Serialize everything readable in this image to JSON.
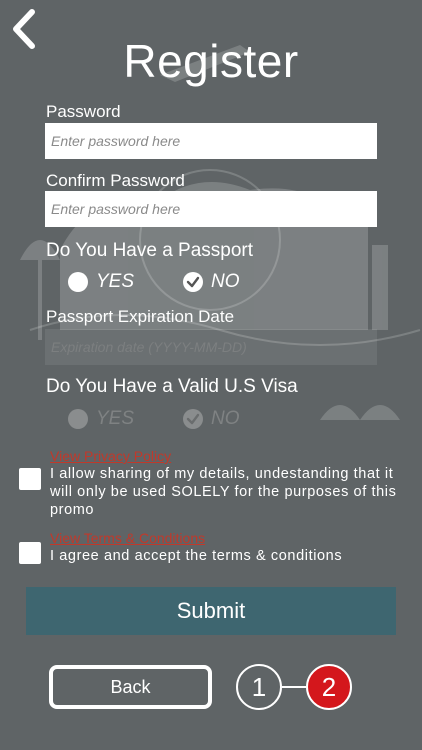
{
  "header": {
    "title": "Register"
  },
  "form": {
    "password": {
      "label": "Password",
      "placeholder": "Enter password here"
    },
    "confirm_password": {
      "label": "Confirm Password",
      "placeholder": "Enter password here"
    },
    "passport_question": {
      "label": "Do You Have a Passport",
      "options": [
        "YES",
        "NO"
      ],
      "selected": "NO"
    },
    "passport_expiration": {
      "label": "Passport Expiration Date",
      "placeholder": "Expiration date (YYYY-MM-DD)"
    },
    "visa_question": {
      "label": "Do You Have a Valid U.S Visa",
      "options": [
        "YES",
        "NO"
      ],
      "selected": "NO",
      "disabled": true
    }
  },
  "consents": {
    "privacy": {
      "link": "View Privacy Policy",
      "text": "I allow sharing of my details, undestanding that it will only be used SOLELY for the purposes of this promo",
      "checked": false
    },
    "terms": {
      "link": "View Terms & Conditions",
      "text": "I agree and accept the terms & conditions",
      "checked": false
    }
  },
  "actions": {
    "submit_label": "Submit",
    "back_label": "Back"
  },
  "steps": {
    "step1": "1",
    "step2": "2",
    "current": 2
  },
  "colors": {
    "background": "#5f6466",
    "submit": "#3e6670",
    "link": "#c0392b",
    "active_step": "#d4171c"
  },
  "icons": {
    "back": "chevron-left-icon",
    "check": "checkmark-icon"
  }
}
